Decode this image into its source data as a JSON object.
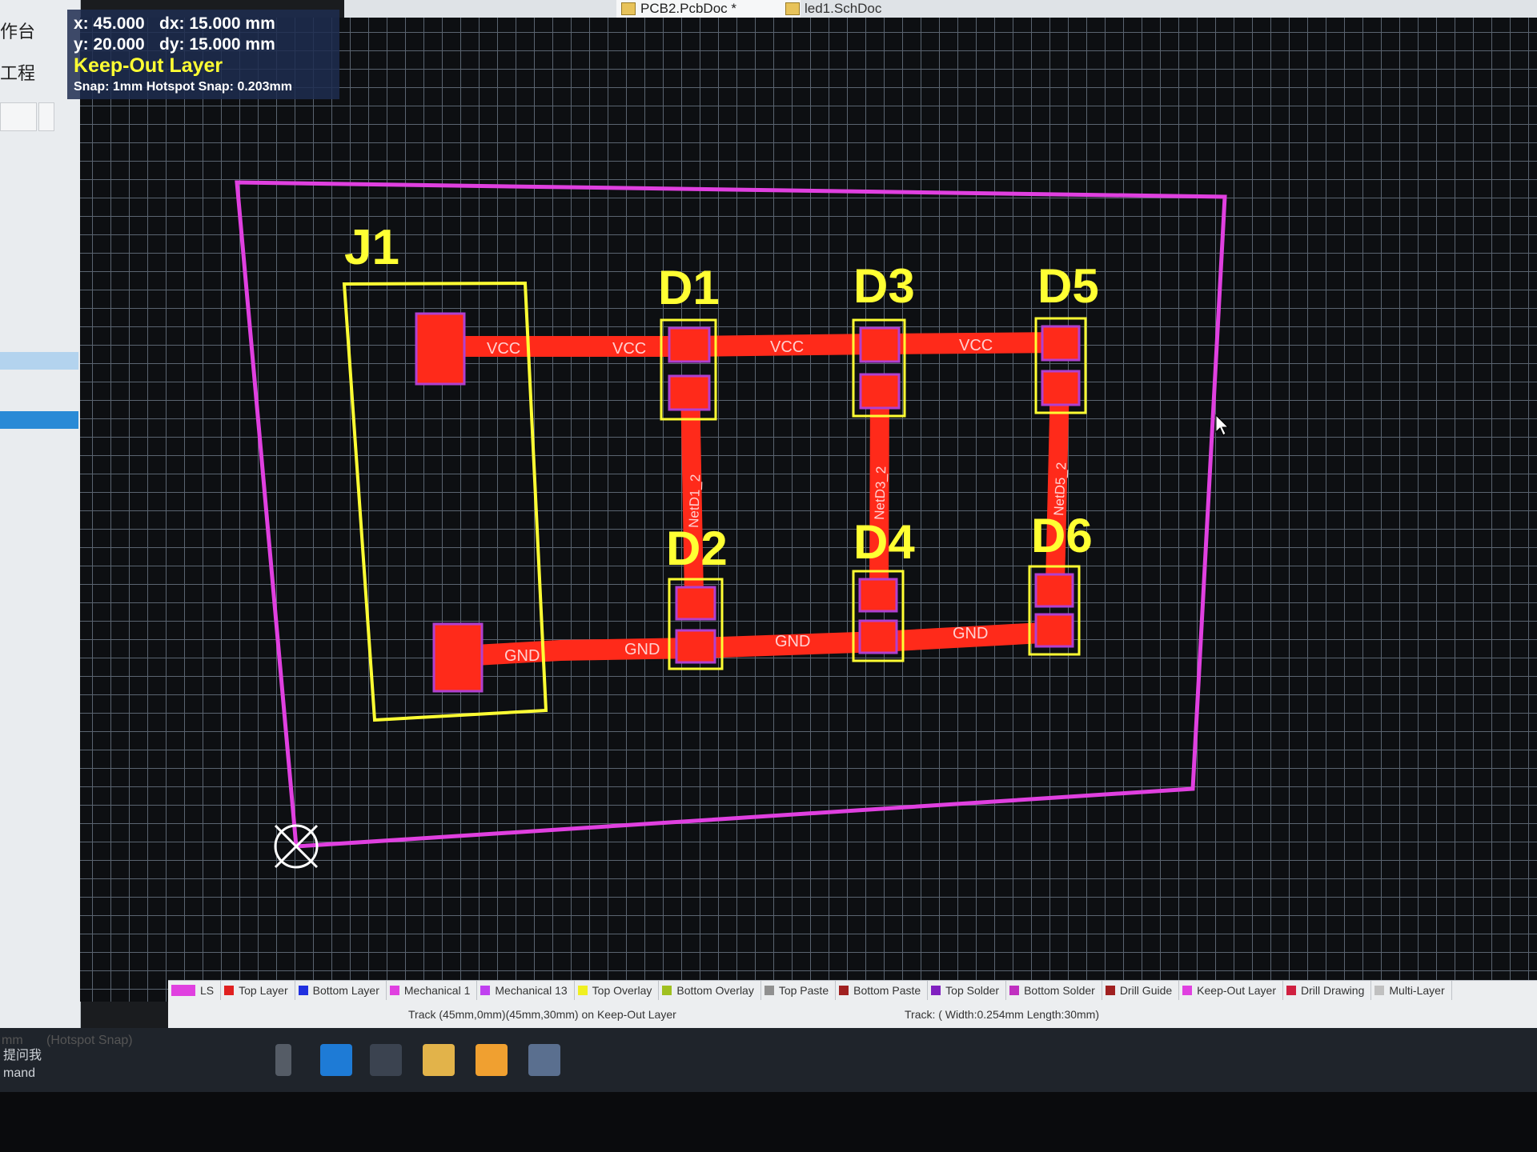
{
  "tabs": [
    {
      "label": "PCB2.PcbDoc *",
      "active": true
    },
    {
      "label": "led1.SchDoc",
      "active": false
    }
  ],
  "sidebar": {
    "labels": [
      "作台",
      "工程"
    ],
    "bottom": {
      "unit": "mm",
      "snap": "(Hotspot Snap)",
      "command": "mand",
      "hint": "提问我"
    }
  },
  "hud": {
    "x": "x: 45.000",
    "dx": "dx: 15.000  mm",
    "y": "y: 20.000",
    "dy": "dy: 15.000  mm",
    "layer": "Keep-Out Layer",
    "snap": "Snap: 1mm Hotspot Snap: 0.203mm"
  },
  "designators": {
    "J1": "J1",
    "D1": "D1",
    "D2": "D2",
    "D3": "D3",
    "D4": "D4",
    "D5": "D5",
    "D6": "D6"
  },
  "nets": {
    "vcc": "VCC",
    "gnd": "GND",
    "netd1": "NetD1_2",
    "netd3": "NetD3_2",
    "netd5": "NetD5_2"
  },
  "layer_tabs": [
    {
      "label": "Top Layer",
      "color": "#e02020"
    },
    {
      "label": "Bottom Layer",
      "color": "#2030e0"
    },
    {
      "label": "Mechanical 1",
      "color": "#e040e0"
    },
    {
      "label": "Mechanical 13",
      "color": "#c040f0"
    },
    {
      "label": "Top Overlay",
      "color": "#f0f020"
    },
    {
      "label": "Bottom Overlay",
      "color": "#a0c020"
    },
    {
      "label": "Top Paste",
      "color": "#909090"
    },
    {
      "label": "Bottom Paste",
      "color": "#a02020"
    },
    {
      "label": "Top Solder",
      "color": "#8020c0"
    },
    {
      "label": "Bottom Solder",
      "color": "#c030c0"
    },
    {
      "label": "Drill Guide",
      "color": "#a02020"
    },
    {
      "label": "Keep-Out Layer",
      "color": "#e040e0"
    },
    {
      "label": "Drill Drawing",
      "color": "#d02040"
    },
    {
      "label": "Multi-Layer",
      "color": "#c0c0c0"
    }
  ],
  "ls_label": "LS",
  "status": {
    "track_left": "Track (45mm,0mm)(45mm,30mm) on Keep-Out Layer",
    "track_right": "Track: ( Width:0.254mm Length:30mm)"
  },
  "colors": {
    "keepout": "#e040e0",
    "copper": "#ff2a1a",
    "overlay": "#ffff33",
    "pad_border": "#b040d0"
  }
}
